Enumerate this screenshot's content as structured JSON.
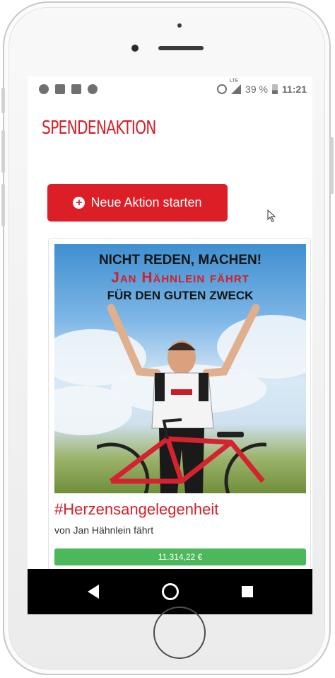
{
  "status_bar": {
    "icons_left": [
      "minus-circle-icon",
      "image-icon",
      "news-icon",
      "app-icon"
    ],
    "icons_right": [
      "alarm-icon",
      "lte-signal-icon",
      "battery-icon"
    ],
    "lte_label": "LTE",
    "battery_percent": "39 %",
    "time": "11:21"
  },
  "brand": {
    "title": "SPENDENAKTION",
    "color": "#d4202a"
  },
  "new_action": {
    "label": "Neue Aktion starten",
    "icon": "plus-circle-icon",
    "color": "#dc1f26"
  },
  "campaign": {
    "image_line1": "NICHT REDEN, MACHEN!",
    "image_line2": "Jan Hähnlein fährt",
    "image_line3": "FÜR DEN GUTEN ZWECK",
    "title": "#Herzensangelegenheit",
    "author": "von Jan Hähnlein fährt",
    "raised": "11.314,22 €",
    "progress_fraction": 1.0,
    "progress_color": "#4cb85c"
  },
  "android_nav": {
    "buttons": [
      "back-icon",
      "home-icon",
      "recent-apps-icon"
    ]
  }
}
